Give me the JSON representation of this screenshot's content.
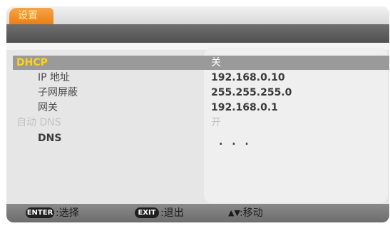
{
  "tab": {
    "label": "设置"
  },
  "rows": [
    {
      "label": "DHCP",
      "value": "关"
    },
    {
      "label": "IP 地址",
      "value": "192.168.0.10"
    },
    {
      "label": "子网屏蔽",
      "value": "255.255.255.0"
    },
    {
      "label": "网关",
      "value": "192.168.0.1"
    },
    {
      "label": "自动 DNS",
      "value": "开"
    },
    {
      "label": "DNS",
      "value": ". . ."
    }
  ],
  "footer": {
    "enter_key": "ENTER",
    "enter_desc": ":选择",
    "exit_key": "EXIT",
    "exit_desc": ":退出",
    "move_glyph": "▲▼",
    "move_desc": ":移动"
  },
  "colors": {
    "accent": "#ec7f12",
    "selected_label": "#ffd21a",
    "highlight_bar": "#9a9a9a"
  }
}
